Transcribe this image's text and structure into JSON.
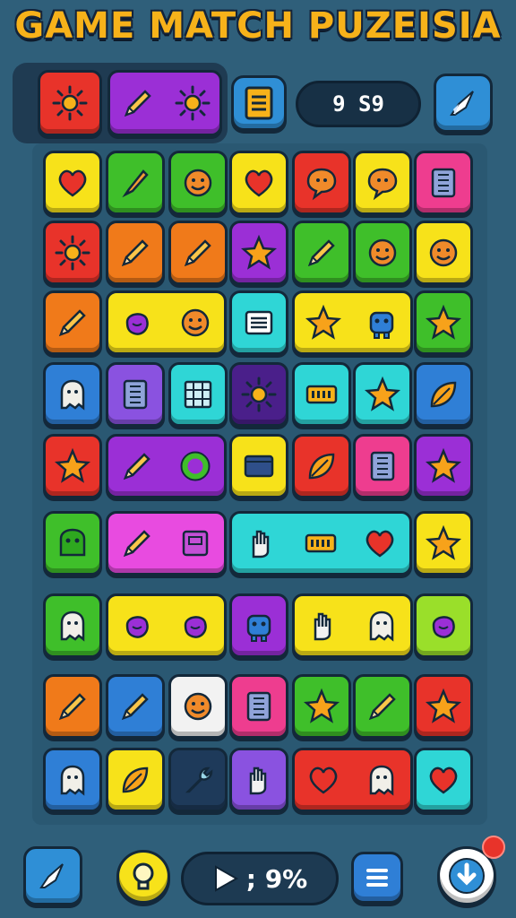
{
  "title": "GAME MATCH PUZEISIA",
  "score_display": "9 S9",
  "bottom_bar": {
    "progress_label": "; 9%"
  },
  "colors": {
    "red": "#e8332a",
    "purple": "#9b2fd6",
    "green": "#3fbf2a",
    "yellow": "#f7e21a",
    "orange": "#f07a1a",
    "pink": "#ee3d8f",
    "blue": "#2f7fd6",
    "cyan": "#2fd6d6",
    "violet": "#8a52e0",
    "darkpurple": "#4a1f8a",
    "magenta": "#e84be0",
    "white": "#f2f2f2",
    "navy": "#1e3a5a",
    "lime": "#9adf2a"
  },
  "top_tiles": [
    {
      "color": "red",
      "icons": [
        "sun-icon"
      ]
    },
    {
      "color": "purple",
      "icons": [
        "pencil-icon",
        "sun-icon"
      ]
    }
  ],
  "grid": [
    [
      {
        "c": "yellow",
        "i": [
          "heart-icon"
        ]
      },
      {
        "c": "green",
        "i": [
          "brush-icon"
        ]
      },
      {
        "c": "green",
        "i": [
          "smiley-icon"
        ]
      },
      {
        "c": "yellow",
        "i": [
          "heart-icon"
        ]
      },
      {
        "c": "red",
        "i": [
          "bubble-icon"
        ]
      },
      {
        "c": "yellow",
        "i": [
          "bubble-icon"
        ]
      },
      {
        "c": "pink",
        "i": [
          "book-icon"
        ]
      }
    ],
    [
      {
        "c": "red",
        "i": [
          "sun-icon"
        ]
      },
      {
        "c": "orange",
        "i": [
          "pencil-icon"
        ]
      },
      {
        "c": "orange",
        "i": [
          "pencil-icon"
        ]
      },
      {
        "c": "purple",
        "i": [
          "star-icon"
        ]
      },
      {
        "c": "green",
        "i": [
          "pencil-icon"
        ]
      },
      {
        "c": "green",
        "i": [
          "smiley-icon"
        ]
      },
      {
        "c": "yellow",
        "i": [
          "smiley-icon"
        ]
      }
    ],
    [
      {
        "c": "orange",
        "i": [
          "pencil-icon"
        ]
      },
      {
        "c": "yellow",
        "span": 2,
        "i": [
          "blob-icon",
          "smiley-icon"
        ]
      },
      {
        "c": "cyan",
        "i": [
          "note-icon"
        ]
      },
      {
        "c": "yellow",
        "span": 2,
        "i": [
          "star-icon",
          "robot-icon"
        ]
      },
      {
        "c": "green",
        "i": [
          "star-icon"
        ]
      }
    ],
    [
      {
        "c": "blue",
        "i": [
          "ghost-icon"
        ]
      },
      {
        "c": "violet",
        "i": [
          "book-icon"
        ]
      },
      {
        "c": "cyan",
        "i": [
          "grid-icon"
        ]
      },
      {
        "c": "darkpurple",
        "i": [
          "sun-icon"
        ]
      },
      {
        "c": "cyan",
        "i": [
          "keyboard-icon"
        ]
      },
      {
        "c": "cyan",
        "i": [
          "star-icon"
        ]
      },
      {
        "c": "blue",
        "i": [
          "leaf-icon"
        ]
      }
    ],
    [
      {
        "c": "red",
        "i": [
          "star-icon"
        ]
      },
      {
        "c": "purple",
        "span": 2,
        "i": [
          "pencil-icon",
          "ring-icon"
        ]
      },
      {
        "c": "yellow",
        "i": [
          "folder-icon"
        ]
      },
      {
        "c": "red",
        "i": [
          "leaf-icon"
        ]
      },
      {
        "c": "pink",
        "i": [
          "book-icon"
        ]
      },
      {
        "c": "purple",
        "i": [
          "star-icon"
        ]
      }
    ],
    [
      {
        "c": "green",
        "i": [
          "monster-icon"
        ]
      },
      {
        "c": "magenta",
        "span": 2,
        "i": [
          "pencil-icon",
          "box-icon"
        ]
      },
      {
        "c": "cyan",
        "span": 3,
        "i": [
          "hand-icon",
          "keyboard-icon",
          "heart-icon"
        ]
      },
      {
        "c": "yellow",
        "i": [
          "star-icon"
        ]
      }
    ],
    [
      {
        "c": "green",
        "i": [
          "ghost-icon"
        ]
      },
      {
        "c": "yellow",
        "span": 2,
        "i": [
          "blob-icon",
          "blob-icon"
        ]
      },
      {
        "c": "purple",
        "i": [
          "robot-icon"
        ]
      },
      {
        "c": "yellow",
        "span": 2,
        "i": [
          "hand-icon",
          "ghost-icon"
        ]
      },
      {
        "c": "lime",
        "i": [
          "blob-icon"
        ]
      }
    ],
    [
      {
        "c": "orange",
        "i": [
          "pencil-icon"
        ]
      },
      {
        "c": "blue",
        "i": [
          "pencil-icon"
        ]
      },
      {
        "c": "white",
        "i": [
          "smiley-icon"
        ]
      },
      {
        "c": "pink",
        "i": [
          "book-icon"
        ]
      },
      {
        "c": "green",
        "i": [
          "star-icon"
        ]
      },
      {
        "c": "green",
        "i": [
          "pencil-icon"
        ]
      },
      {
        "c": "red",
        "i": [
          "star-icon"
        ]
      }
    ],
    [
      {
        "c": "blue",
        "i": [
          "ghost-icon"
        ]
      },
      {
        "c": "yellow",
        "i": [
          "leaf-icon"
        ]
      },
      {
        "c": "navy",
        "i": [
          "wrench-icon"
        ]
      },
      {
        "c": "violet",
        "i": [
          "hand-icon"
        ]
      },
      {
        "c": "red",
        "span": 2,
        "i": [
          "heart-icon",
          "ghost-icon"
        ]
      },
      {
        "c": "cyan",
        "i": [
          "heart-icon"
        ]
      }
    ]
  ]
}
